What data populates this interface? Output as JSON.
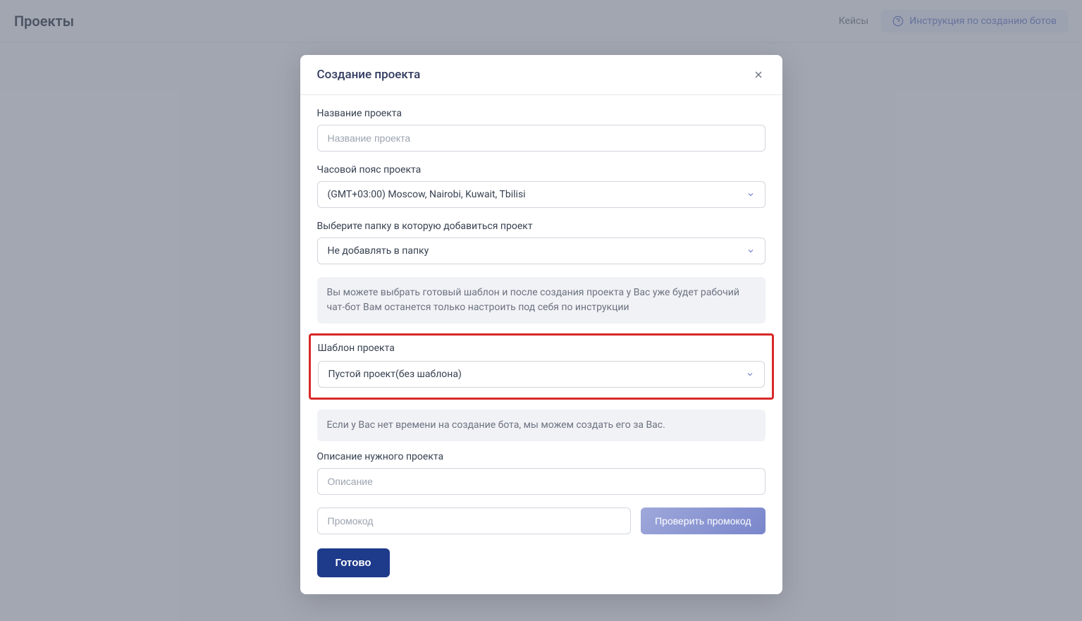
{
  "header": {
    "title": "Проекты",
    "cases_link": "Кейсы",
    "instructions_label": "Инструкция по созданию ботов"
  },
  "modal": {
    "title": "Создание проекта",
    "fields": {
      "project_name": {
        "label": "Название проекта",
        "placeholder": "Название проекта"
      },
      "timezone": {
        "label": "Часовой пояс проекта",
        "value": "(GMT+03:00) Moscow, Nairobi, Kuwait, Tbilisi"
      },
      "folder": {
        "label": "Выберите папку в которую добавиться проект",
        "value": "Не добавлять в папку"
      },
      "template_info": "Вы можете выбрать готовый шаблон и после создания проекта у Вас уже будет рабочий чат-бот Вам останется только настроить под себя по инструкции",
      "template": {
        "label": "Шаблон проекта",
        "value": "Пустой проект(без шаблона)"
      },
      "description_info": "Если у Вас нет времени на создание бота, мы можем создать его за Вас.",
      "description": {
        "label": "Описание нужного проекта",
        "placeholder": "Описание"
      },
      "promo": {
        "placeholder": "Промокод",
        "button": "Проверить промокод"
      },
      "submit": "Готово"
    }
  }
}
